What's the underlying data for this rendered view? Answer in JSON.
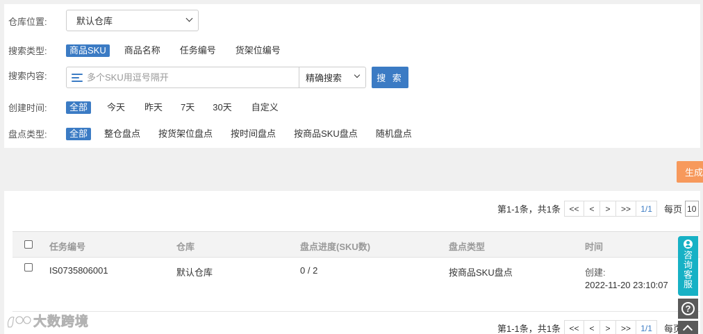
{
  "filters": {
    "warehouse": {
      "label": "仓库位置:",
      "value": "默认仓库"
    },
    "search_type": {
      "label": "搜索类型:",
      "options": [
        "商品SKU",
        "商品名称",
        "任务编号",
        "货架位编号"
      ],
      "active_index": 0
    },
    "search_content": {
      "label": "搜索内容:",
      "placeholder": "多个SKU用逗号隔开",
      "mode": "精确搜索",
      "button": "搜 索"
    },
    "created_time": {
      "label": "创建时间:",
      "options": [
        "全部",
        "今天",
        "昨天",
        "7天",
        "30天",
        "自定义"
      ],
      "active_index": 0
    },
    "inventory_type": {
      "label": "盘点类型:",
      "options": [
        "全部",
        "整仓盘点",
        "按货架位盘点",
        "按时间盘点",
        "按商品SKU盘点",
        "随机盘点"
      ],
      "active_index": 0
    }
  },
  "generate_button": "生成",
  "pagination": {
    "summary": "第1-1条，共1条",
    "buttons": [
      "<<",
      "<",
      ">",
      ">>"
    ],
    "current": "1/1",
    "per_page_label": "每页",
    "per_page_value": "10"
  },
  "table": {
    "columns": [
      "任务编号",
      "仓库",
      "盘点进度(SKU数)",
      "盘点类型",
      "时间"
    ],
    "rows": [
      {
        "task_no": "IS0735806001",
        "warehouse": "默认仓库",
        "progress": "0 / 2",
        "type": "按商品SKU盘点",
        "time_label": "创建:",
        "time_value": "2022-11-20 23:10:07"
      }
    ]
  },
  "side_widgets": {
    "kefu_label": "咨询客服",
    "help": "?"
  },
  "watermark": "大数跨境",
  "colors": {
    "primary": "#3b7bc4",
    "orange": "#f7995c",
    "teal": "#17b1c5"
  }
}
